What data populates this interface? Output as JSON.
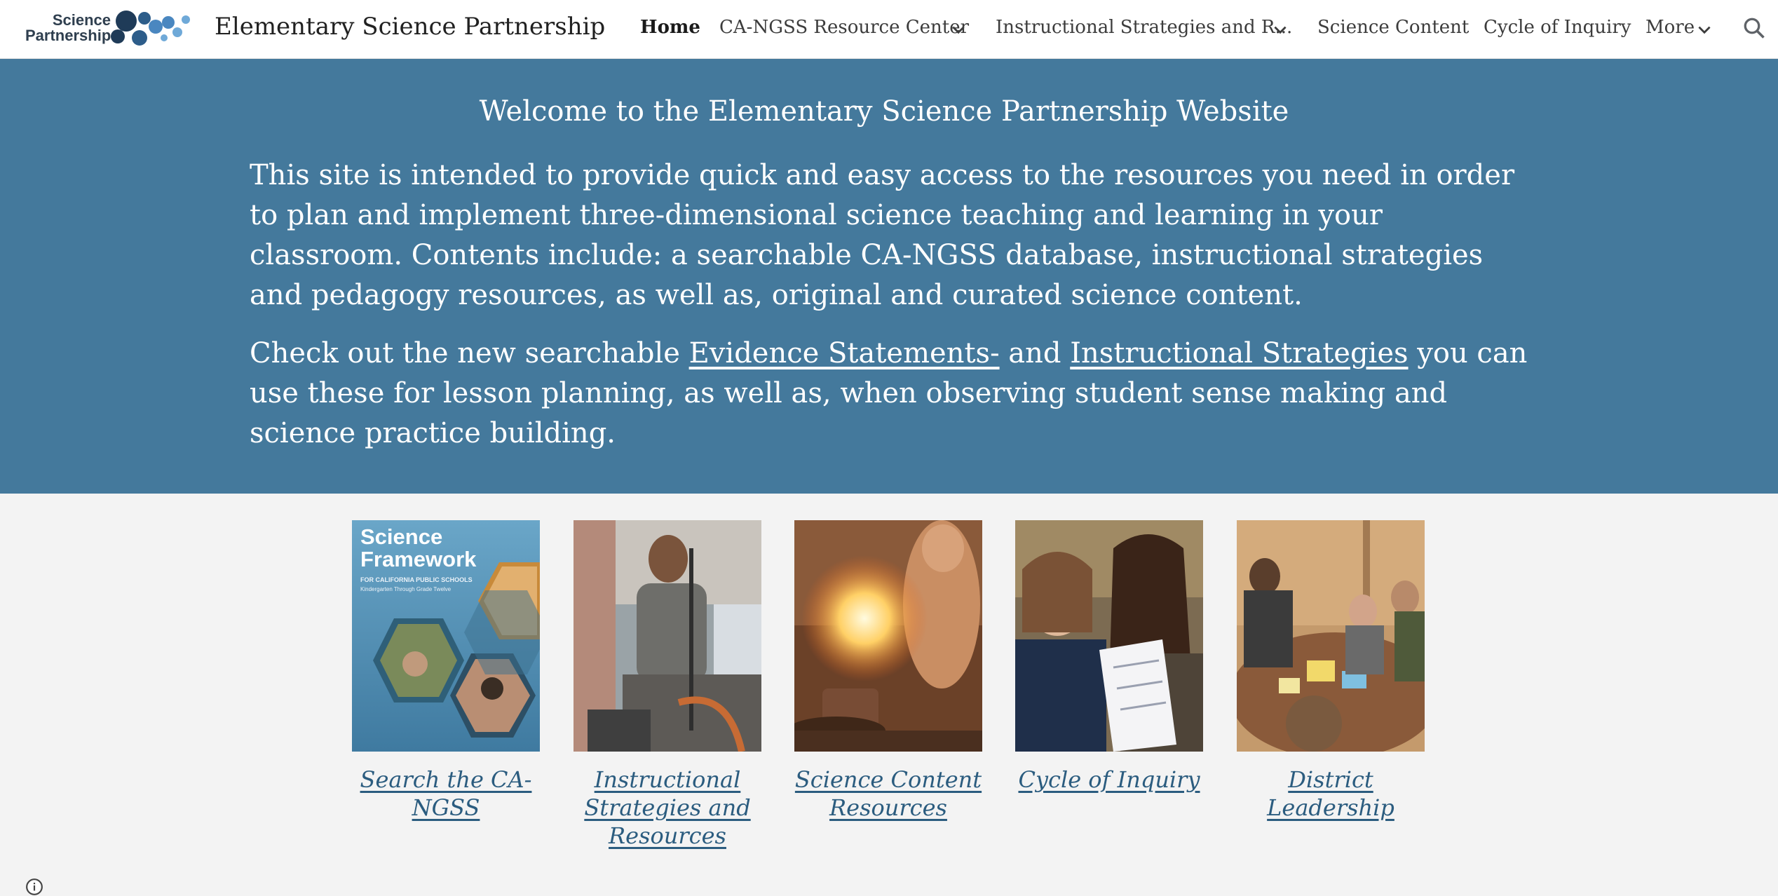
{
  "header": {
    "logo_line1": "Science",
    "logo_line2": "Partnership",
    "site_title": "Elementary Science Partnership",
    "nav": [
      {
        "label": "Home",
        "active": true
      },
      {
        "label": "CA-NGSS Resource Center",
        "has_dropdown": true
      },
      {
        "label": "Instructional Strategies and R...",
        "has_dropdown": true
      },
      {
        "label": "Science Content"
      },
      {
        "label": "Cycle of Inquiry"
      },
      {
        "label": "More",
        "has_dropdown": true
      }
    ],
    "search_icon": "search-icon",
    "logo_colors": [
      "#1f3b58",
      "#2d5d8a",
      "#4a87c0",
      "#6fa9d8"
    ]
  },
  "banner": {
    "background_color": "#44799c",
    "heading": "Welcome to the Elementary Science Partnership Website",
    "paragraph1": "This site is intended to provide quick and easy access to the resources you need in order to plan and implement three-dimensional science teaching and learning in your classroom.  Contents include: a searchable CA-NGSS database, instructional strategies and pedagogy resources, as well as, original and curated science content.",
    "paragraph2": {
      "before": "Check out the new searchable ",
      "link1": "Evidence Statements-",
      "middle": " and ",
      "link2": "Instructional Strategies",
      "after": " you can use these for lesson planning, as well as, when observing student sense making and science practice building."
    }
  },
  "cards": [
    {
      "label": "Search the CA-NGSS",
      "image": "Science Framework for California Public Schools book cover",
      "cover_title": "Science Framework",
      "cover_subtitle": "FOR CALIFORNIA PUBLIC SCHOOLS",
      "cover_subtitle2": "Kindergarten Through Grade Twelve"
    },
    {
      "label": "Instructional Strategies and Resources",
      "image": "teacher with lab stand"
    },
    {
      "label": "Science Content Resources",
      "image": "flame experiment"
    },
    {
      "label": "Cycle of Inquiry",
      "image": "teachers reading handout"
    },
    {
      "label": "District Leadership",
      "image": "group at table"
    }
  ],
  "footer": {
    "info_icon": "info-icon"
  }
}
